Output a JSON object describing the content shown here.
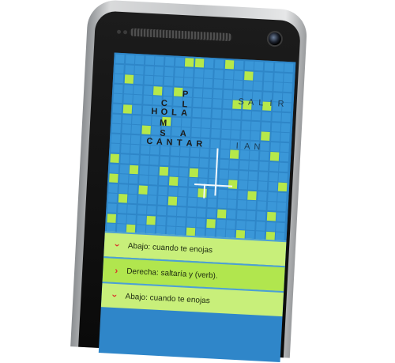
{
  "board": {
    "words": [
      {
        "text": "HOLA",
        "direction": "across"
      },
      {
        "text": "CANTAR",
        "direction": "across"
      },
      {
        "text": "IAN",
        "direction": "across",
        "ghost": true
      },
      {
        "text": "SALIR",
        "direction": "across",
        "ghost": true
      },
      {
        "text": "CPMS",
        "direction": "down"
      },
      {
        "text": "PLATA",
        "direction": "down"
      }
    ],
    "colors": {
      "board": "#2e86c8",
      "cell": "#3a97d8",
      "lit_cell": "#b6e84a",
      "accent": "#d9342b"
    }
  },
  "clues": [
    {
      "direction_icon": "chevron-down-icon",
      "text": "Abajo: cuando te enojas"
    },
    {
      "direction_icon": "chevron-right-icon",
      "text": "Derecha: saltaría y (verb)."
    },
    {
      "direction_icon": "chevron-down-icon",
      "text": "Abajo: cuando te enojas"
    }
  ]
}
